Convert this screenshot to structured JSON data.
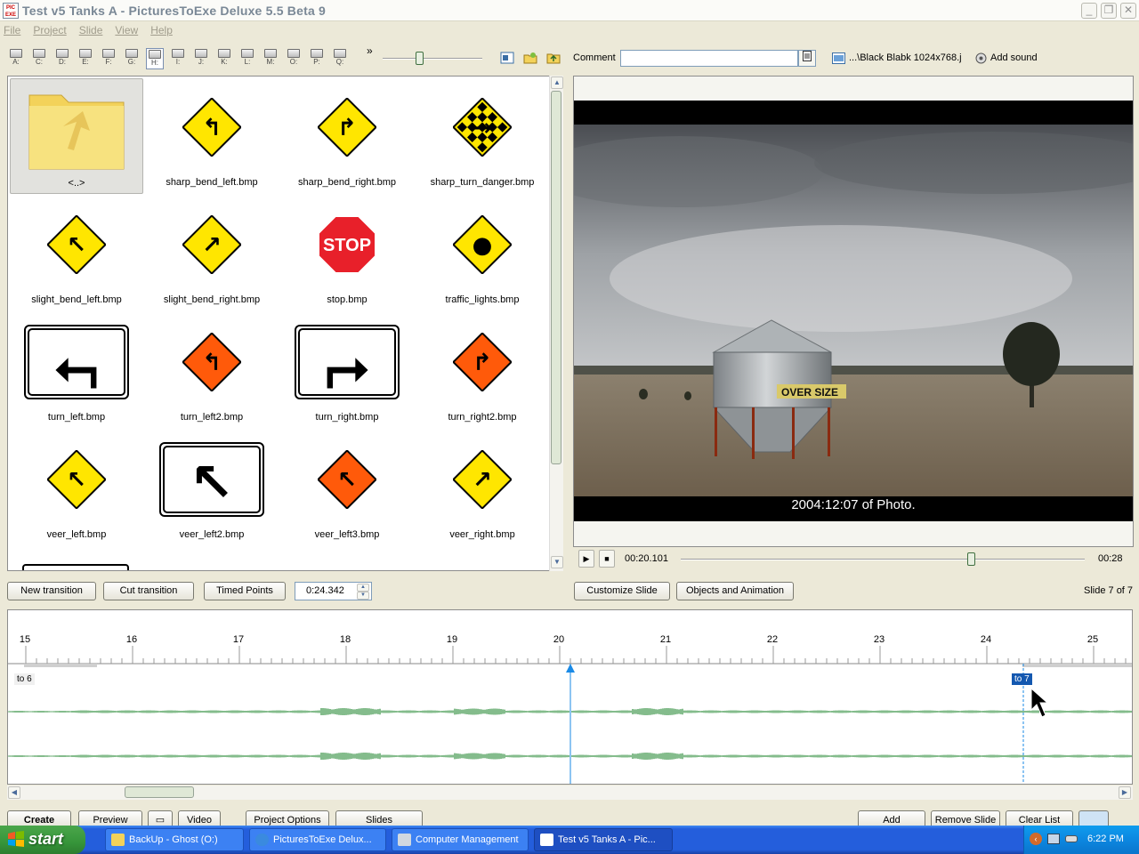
{
  "window": {
    "title": "Test v5 Tanks A - PicturesToExe Deluxe 5.5 Beta 9"
  },
  "menu": [
    "File",
    "Project",
    "Slide",
    "View",
    "Help"
  ],
  "drives": [
    "A:",
    "C:",
    "D:",
    "E:",
    "F:",
    "G:",
    "H:",
    "I:",
    "J:",
    "K:",
    "L:",
    "M:",
    "O:",
    "P:",
    "Q:"
  ],
  "toolbar": {
    "more": "»",
    "comment_label": "Comment",
    "comment_value": "",
    "background_file": "...\\Black Blabk 1024x768.j",
    "add_sound": "Add sound"
  },
  "files": [
    {
      "name": "<..>",
      "kind": "folder"
    },
    {
      "name": "sharp_bend_left.bmp",
      "kind": "diamond",
      "color": "#ffe600",
      "glyph": "↰"
    },
    {
      "name": "sharp_bend_right.bmp",
      "kind": "diamond",
      "color": "#ffe600",
      "glyph": "↱"
    },
    {
      "name": "sharp_turn_danger.bmp",
      "kind": "checker",
      "color": "#ffe600",
      "glyph": "→"
    },
    {
      "name": "slight_bend_left.bmp",
      "kind": "diamond",
      "color": "#ffe600",
      "glyph": "↖"
    },
    {
      "name": "slight_bend_right.bmp",
      "kind": "diamond",
      "color": "#ffe600",
      "glyph": "↗"
    },
    {
      "name": "stop.bmp",
      "kind": "stop",
      "color": "#e8202a",
      "glyph": "STOP"
    },
    {
      "name": "traffic_lights.bmp",
      "kind": "diamond",
      "color": "#ffe600",
      "glyph": "●"
    },
    {
      "name": "turn_left.bmp",
      "kind": "rect",
      "color": "#ffffff",
      "glyph": "⮢"
    },
    {
      "name": "turn_left2.bmp",
      "kind": "diamond",
      "color": "#ff5a0a",
      "glyph": "↰"
    },
    {
      "name": "turn_right.bmp",
      "kind": "rect",
      "color": "#ffffff",
      "glyph": "⮣"
    },
    {
      "name": "turn_right2.bmp",
      "kind": "diamond",
      "color": "#ff5a0a",
      "glyph": "↱"
    },
    {
      "name": "veer_left.bmp",
      "kind": "diamond",
      "color": "#ffe600",
      "glyph": "↖"
    },
    {
      "name": "veer_left2.bmp",
      "kind": "rect",
      "color": "#ffffff",
      "glyph": "↖"
    },
    {
      "name": "veer_left3.bmp",
      "kind": "diamond",
      "color": "#ff5a0a",
      "glyph": "↖"
    },
    {
      "name": "veer_right.bmp",
      "kind": "diamond",
      "color": "#ffe600",
      "glyph": "↗"
    }
  ],
  "preview": {
    "caption": "2004:12:07 of Photo.",
    "sign_text": "OVER SIZE",
    "current_time": "00:20.101",
    "total_time": "00:28",
    "position": 0.718
  },
  "actions": {
    "new_transition": "New transition",
    "cut_transition": "Cut transition",
    "timed_points": "Timed Points",
    "time_value": "0:24.342",
    "customize_slide": "Customize Slide",
    "objects_animation": "Objects and Animation",
    "slide_count": "Slide 7 of 7"
  },
  "timeline": {
    "ticks": [
      "15",
      "16",
      "17",
      "18",
      "19",
      "20",
      "21",
      "22",
      "23",
      "24",
      "25"
    ],
    "marker_prev": "to 6",
    "marker_current": "to 7"
  },
  "bottom": {
    "create": "Create",
    "preview": "Preview",
    "video": "Video",
    "project_options": "Project Options",
    "slides": "Slides",
    "add": "Add",
    "remove_slide": "Remove Slide",
    "clear_list": "Clear List"
  },
  "taskbar": {
    "start": "start",
    "tasks": [
      "BackUp - Ghost (O:)",
      "PicturesToExe Delux...",
      "Computer Management",
      "Test v5 Tanks A - Pic..."
    ],
    "clock": "6:22 PM"
  }
}
